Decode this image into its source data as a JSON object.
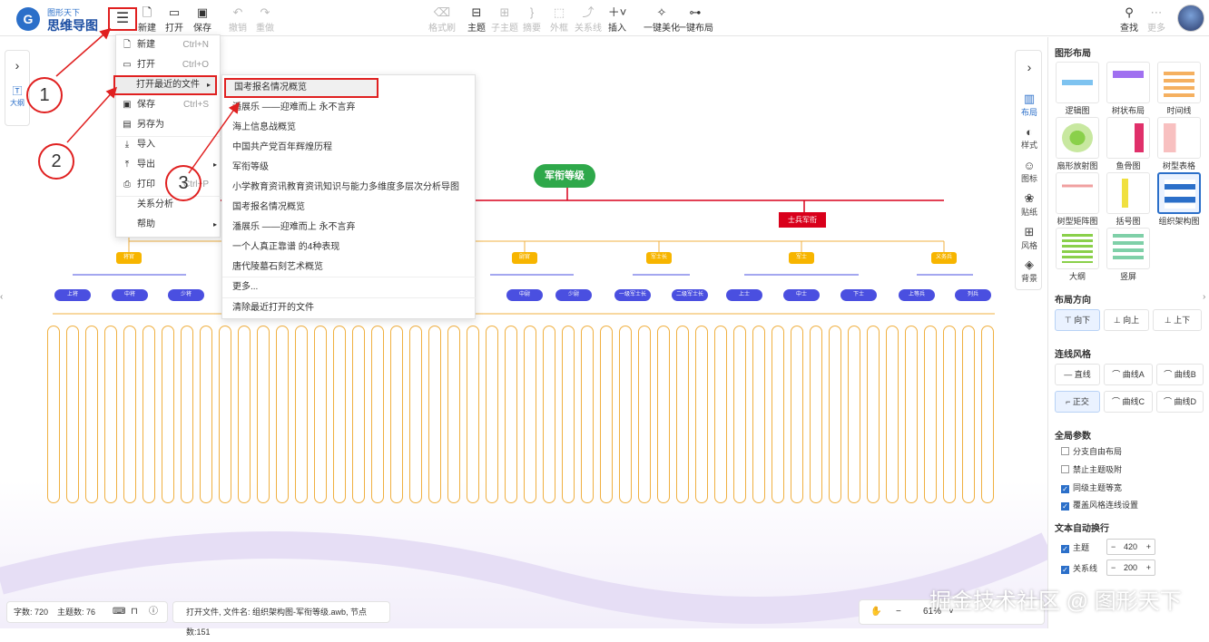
{
  "brand": {
    "name_top": "图形天下",
    "name_main": "思维导图",
    "mark": "G"
  },
  "toolbar": {
    "menu_icon": "menu-icon",
    "items": [
      {
        "label": "新建",
        "icon": "new-file-icon"
      },
      {
        "label": "打开",
        "icon": "folder-icon"
      },
      {
        "label": "保存",
        "icon": "save-icon"
      },
      {
        "label": "撤销",
        "icon": "undo-icon"
      },
      {
        "label": "重做",
        "icon": "redo-icon"
      },
      {
        "label": "格式刷",
        "icon": "brush-icon"
      },
      {
        "label": "主题",
        "icon": "topic-icon"
      },
      {
        "label": "子主题",
        "icon": "subtopic-icon"
      },
      {
        "label": "摘要",
        "icon": "summary-icon"
      },
      {
        "label": "外框",
        "icon": "boundary-icon"
      },
      {
        "label": "关系线",
        "icon": "relation-icon"
      },
      {
        "label": "插入",
        "icon": "plus-icon"
      },
      {
        "label": "一键美化",
        "icon": "magic-icon"
      },
      {
        "label": "一键布局",
        "icon": "layout-icon"
      }
    ],
    "search": "查找",
    "more": "更多"
  },
  "main_menu": [
    {
      "label": "新建",
      "shortcut": "Ctrl+N"
    },
    {
      "label": "打开",
      "shortcut": "Ctrl+O"
    },
    {
      "label": "打开最近的文件",
      "shortcut": ""
    },
    {
      "label": "保存",
      "shortcut": "Ctrl+S"
    },
    {
      "label": "另存为",
      "shortcut": ""
    },
    {
      "label": "导入",
      "shortcut": ""
    },
    {
      "label": "导出",
      "shortcut": ""
    },
    {
      "label": "打印",
      "shortcut": "Ctrl+P"
    },
    {
      "label": "关系分析",
      "shortcut": ""
    },
    {
      "label": "帮助",
      "shortcut": ""
    }
  ],
  "recent_files": [
    "国考报名情况概览",
    "潘展乐 ——迎难而上 永不言弃",
    "海上信息战概览",
    "中国共产党百年辉煌历程",
    "军衔等级",
    "小学教育资讯教育资讯知识与能力多维度多层次分析导图",
    "国考报名情况概览",
    "潘展乐 ——迎难而上 永不言弃",
    "一个人真正靠谱 的4种表现",
    "唐代陵墓石刻艺术概览",
    "更多...",
    "清除最近打开的文件"
  ],
  "annotations": [
    "1",
    "2",
    "3"
  ],
  "left_panel": {
    "outline": "大纲"
  },
  "right_tabs": [
    "布局",
    "样式",
    "图标",
    "贴纸",
    "风格",
    "背景"
  ],
  "side": {
    "layout_title": "图形布局",
    "layouts": [
      "逻辑图",
      "树状布局",
      "时间线",
      "扇形放射图",
      "鱼骨图",
      "树型表格",
      "树型矩阵图",
      "括号图",
      "组织架构图",
      "大纲",
      "竖屏"
    ],
    "direction_title": "布局方向",
    "directions": [
      "向下",
      "向上",
      "上下"
    ],
    "line_title": "连线风格",
    "lines": [
      "直线",
      "曲线A",
      "曲线B",
      "正交",
      "曲线C",
      "曲线D"
    ],
    "global_title": "全局参数",
    "checks": [
      {
        "label": "分支自由布局",
        "checked": false
      },
      {
        "label": "禁止主题吸附",
        "checked": false
      },
      {
        "label": "同级主题等宽",
        "checked": true
      },
      {
        "label": "覆盖风格连线设置",
        "checked": true
      }
    ],
    "wrap_title": "文本自动换行",
    "wrap": [
      {
        "label": "主题",
        "value": "420"
      },
      {
        "label": "关系线",
        "value": "200"
      }
    ]
  },
  "map": {
    "root": "军衔等级",
    "red_node": "士兵军衔",
    "yellow_nodes": [
      "将官",
      "校官",
      "尉官",
      "军士长",
      "军士",
      "义务兵"
    ],
    "blue_nodes": [
      "上将",
      "中将",
      "少将",
      "中尉",
      "少尉",
      "一级军士长",
      "二级军士长",
      "上士",
      "中士",
      "下士",
      "上等兵",
      "列兵"
    ]
  },
  "status": {
    "word_count": "字数: 720",
    "topic_count": "主题数: 76",
    "file_info": "打开文件, 文件名: 组织架构图-军衔等级.awb, 节点数:151",
    "zoom": "61%"
  },
  "watermark": "掘金技术社区 @ 图形天下",
  "colors": {
    "accent": "#2b6fc9",
    "highlight_box": "#e02020",
    "root": "#2ea84a",
    "leaf_border": "#f0b040",
    "blue_node": "#4a4fe0",
    "yellow_node": "#f7b500",
    "red_node": "#d9001b"
  }
}
